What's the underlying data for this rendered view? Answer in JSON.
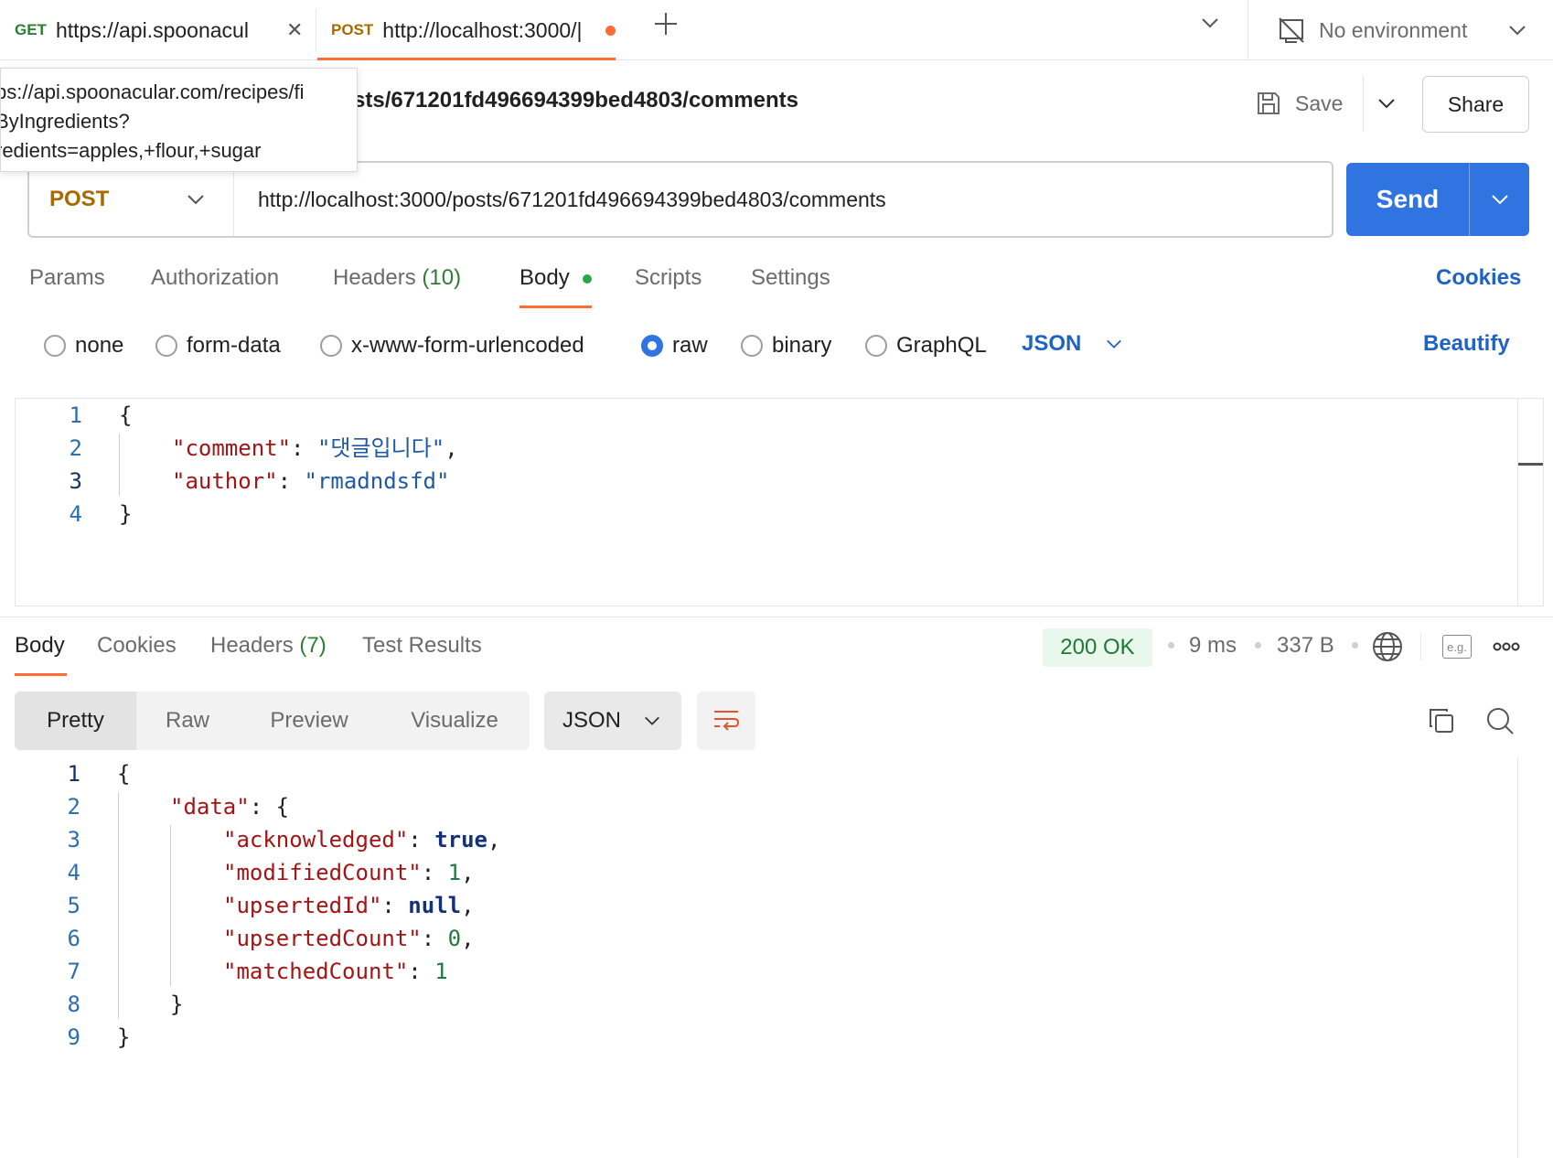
{
  "tabs": [
    {
      "method": "GET",
      "title": "https://api.spoonacul",
      "close": "✕"
    },
    {
      "method": "POST",
      "title": "http://localhost:3000/|",
      "unsaved": true
    }
  ],
  "environment": {
    "label": "No environment"
  },
  "tooltip": {
    "lines": [
      "ps://api.spoonacular.com/recipes/fi",
      "ByIngredients?",
      "redients=apples,+flour,+sugar"
    ]
  },
  "request": {
    "title": "sts/671201fd496694399bed4803/comments",
    "method": "POST",
    "url": "http://localhost:3000/posts/671201fd496694399bed4803/comments",
    "save_label": "Save",
    "share_label": "Share",
    "send_label": "Send"
  },
  "request_tabs": {
    "params": "Params",
    "authorization": "Authorization",
    "headers": "Headers",
    "headers_count": "(10)",
    "body": "Body",
    "scripts": "Scripts",
    "settings": "Settings",
    "cookies": "Cookies"
  },
  "body_types": {
    "none": "none",
    "form_data": "form-data",
    "urlencoded": "x-www-form-urlencoded",
    "raw": "raw",
    "binary": "binary",
    "graphql": "GraphQL",
    "language": "JSON",
    "beautify": "Beautify",
    "selected": "raw"
  },
  "request_body": {
    "line_numbers": [
      "1",
      "2",
      "3",
      "4"
    ],
    "open_brace": "{",
    "close_brace": "}",
    "k1": "\"comment\"",
    "v1": "\"댓글입니다\"",
    "k2": "\"author\"",
    "v2": "\"rmadndsfd\""
  },
  "response_tabs": {
    "body": "Body",
    "cookies": "Cookies",
    "headers": "Headers",
    "headers_count": "(7)",
    "test_results": "Test Results"
  },
  "response_meta": {
    "status": "200 OK",
    "time": "9 ms",
    "size": "337 B",
    "example_icon_text": "e.g."
  },
  "response_view": {
    "pretty": "Pretty",
    "raw": "Raw",
    "preview": "Preview",
    "visualize": "Visualize",
    "language": "JSON"
  },
  "response_body": {
    "line_numbers": [
      "1",
      "2",
      "3",
      "4",
      "5",
      "6",
      "7",
      "8",
      "9"
    ],
    "open_brace": "{",
    "close_brace": "}",
    "data_key": "\"data\"",
    "acknowledged_key": "\"acknowledged\"",
    "acknowledged_val": "true",
    "modifiedCount_key": "\"modifiedCount\"",
    "modifiedCount_val": "1",
    "upsertedId_key": "\"upsertedId\"",
    "upsertedId_val": "null",
    "upsertedCount_key": "\"upsertedCount\"",
    "upsertedCount_val": "0",
    "matchedCount_key": "\"matchedCount\"",
    "matchedCount_val": "1"
  }
}
